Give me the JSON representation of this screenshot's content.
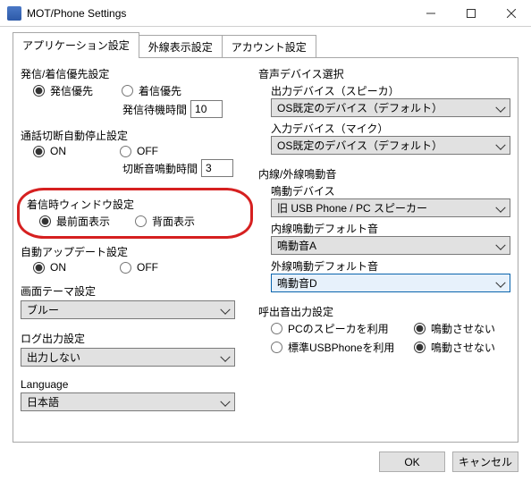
{
  "window": {
    "title": "MOT/Phone Settings",
    "minimize_icon": "minimize-icon",
    "maximize_icon": "maximize-icon",
    "close_icon": "close-icon"
  },
  "tabs": [
    {
      "label": "アプリケーション設定",
      "active": true
    },
    {
      "label": "外線表示設定",
      "active": false
    },
    {
      "label": "アカウント設定",
      "active": false
    }
  ],
  "left": {
    "call_priority": {
      "title": "発信/着信優先設定",
      "option_outgoing": "発信優先",
      "option_incoming": "着信優先",
      "wait_label": "発信待機時間",
      "wait_value": "10"
    },
    "auto_stop": {
      "title": "通話切断自動停止設定",
      "option_on": "ON",
      "option_off": "OFF",
      "duration_label": "切断音鳴動時間",
      "duration_value": "3"
    },
    "incoming_window": {
      "title": "着信時ウィンドウ設定",
      "option_front": "最前面表示",
      "option_back": "背面表示"
    },
    "auto_update": {
      "title": "自動アップデート設定",
      "option_on": "ON",
      "option_off": "OFF"
    },
    "theme": {
      "title": "画面テーマ設定",
      "value": "ブルー"
    },
    "log": {
      "title": "ログ出力設定",
      "value": "出力しない"
    },
    "language": {
      "title": "Language",
      "value": "日本語"
    }
  },
  "right": {
    "audio": {
      "title": "音声デバイス選択",
      "output_label": "出力デバイス（スピーカ）",
      "output_value": "OS既定のデバイス（デフォルト）",
      "input_label": "入力デバイス（マイク）",
      "input_value": "OS既定のデバイス（デフォルト）"
    },
    "ring": {
      "title": "内線/外線鳴動音",
      "device_label": "鳴動デバイス",
      "device_value": "旧 USB Phone / PC スピーカー",
      "internal_label": "内線鳴動デフォルト音",
      "internal_value": "鳴動音A",
      "external_label": "外線鳴動デフォルト音",
      "external_value": "鳴動音D"
    },
    "ring_output": {
      "title": "呼出音出力設定",
      "opt_pc_speaker": "PCのスピーカを利用",
      "opt_no_ring1": "鳴動させない",
      "opt_usb_phone": "標準USBPhoneを利用",
      "opt_no_ring2": "鳴動させない"
    }
  },
  "buttons": {
    "ok": "OK",
    "cancel": "キャンセル"
  }
}
